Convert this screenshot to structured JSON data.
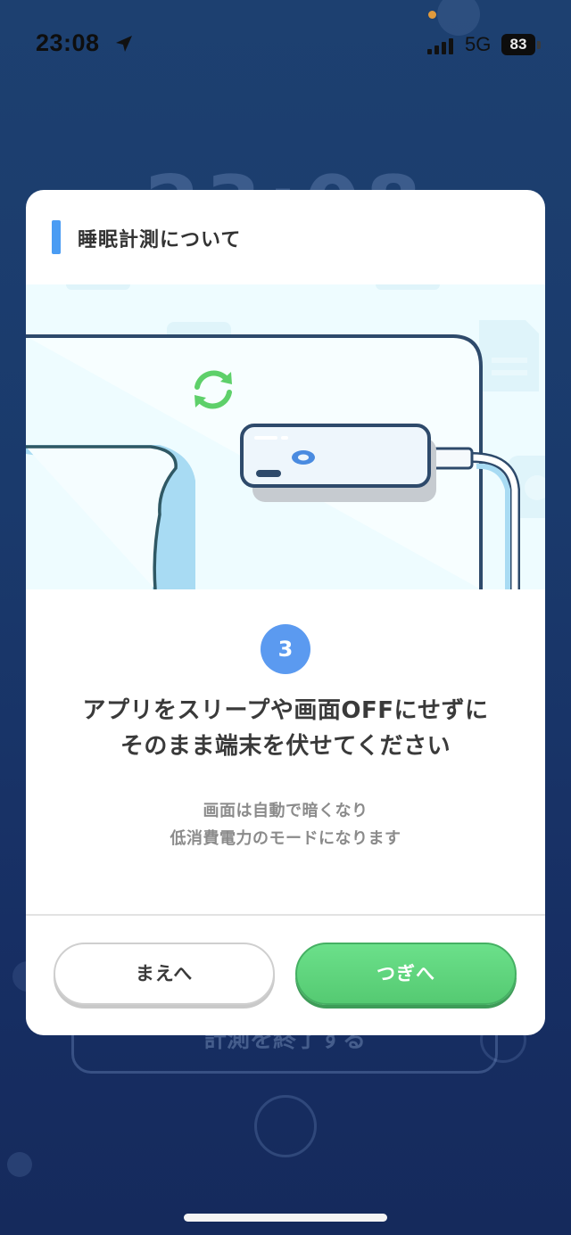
{
  "status_bar": {
    "time": "23:08",
    "network": "5G",
    "battery": "83",
    "location_icon": "location-arrow-icon",
    "signal_icon": "cellular-signal-icon"
  },
  "background": {
    "clock": "23:08",
    "end_button_label": "計測を終了する"
  },
  "modal": {
    "title": "睡眠計測について",
    "illustration_icons": [
      "sync-icon",
      "phone-icon",
      "pillow-icon",
      "charging-cable-icon"
    ],
    "step_number": "3",
    "main_text": [
      "アプリをスリープや画面OFFにせずに",
      "そのまま端末を伏せてください"
    ],
    "sub_text": [
      "画面は自動で暗くなり",
      "低消費電力のモードになります"
    ],
    "buttons": {
      "prev": "まえへ",
      "next": "つぎへ"
    }
  },
  "colors": {
    "accent_blue": "#4a9cf3",
    "step_badge": "#5b9af0",
    "next_button": "#5dd37a",
    "background": "#1a3a6c"
  }
}
